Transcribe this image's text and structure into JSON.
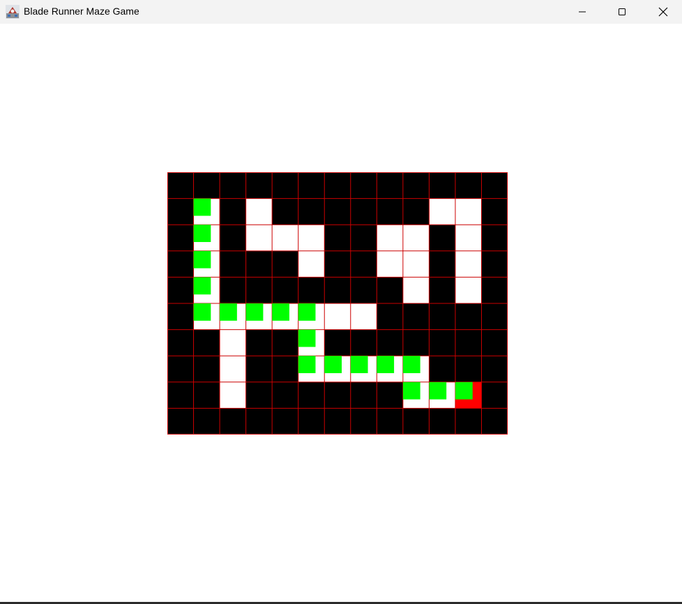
{
  "window": {
    "title": "Blade Runner Maze Game",
    "icon": "java-app-icon",
    "controls": [
      "minimize-icon",
      "maximize-icon",
      "close-icon"
    ]
  },
  "colors": {
    "wall": "#000000",
    "open": "#ffffff",
    "grid_line": "#cc0000",
    "path_marker": "#00ff00",
    "goal": "#ff0000"
  },
  "maze": {
    "rows": 10,
    "cols": 13,
    "legend": "1 = wall, 0 = open",
    "grid": [
      [
        1,
        1,
        1,
        1,
        1,
        1,
        1,
        1,
        1,
        1,
        1,
        1,
        1
      ],
      [
        1,
        0,
        1,
        0,
        1,
        1,
        1,
        1,
        1,
        1,
        0,
        0,
        1
      ],
      [
        1,
        0,
        1,
        0,
        0,
        0,
        1,
        1,
        0,
        0,
        1,
        0,
        1
      ],
      [
        1,
        0,
        1,
        1,
        1,
        0,
        1,
        1,
        0,
        0,
        1,
        0,
        1
      ],
      [
        1,
        0,
        1,
        1,
        1,
        1,
        1,
        1,
        1,
        0,
        1,
        0,
        1
      ],
      [
        1,
        0,
        0,
        0,
        0,
        0,
        0,
        0,
        1,
        1,
        1,
        1,
        1
      ],
      [
        1,
        1,
        0,
        1,
        1,
        0,
        1,
        1,
        1,
        1,
        1,
        1,
        1
      ],
      [
        1,
        1,
        0,
        1,
        1,
        0,
        0,
        0,
        0,
        0,
        1,
        1,
        1
      ],
      [
        1,
        1,
        0,
        1,
        1,
        1,
        1,
        1,
        1,
        0,
        0,
        0,
        1
      ],
      [
        1,
        1,
        1,
        1,
        1,
        1,
        1,
        1,
        1,
        1,
        1,
        1,
        1
      ]
    ],
    "path": [
      [
        1,
        1
      ],
      [
        2,
        1
      ],
      [
        3,
        1
      ],
      [
        4,
        1
      ],
      [
        5,
        1
      ],
      [
        5,
        2
      ],
      [
        5,
        3
      ],
      [
        5,
        4
      ],
      [
        5,
        5
      ],
      [
        6,
        5
      ],
      [
        7,
        5
      ],
      [
        7,
        6
      ],
      [
        7,
        7
      ],
      [
        7,
        8
      ],
      [
        7,
        9
      ],
      [
        8,
        9
      ],
      [
        8,
        10
      ],
      [
        8,
        11
      ]
    ],
    "goal": [
      8,
      11
    ]
  }
}
